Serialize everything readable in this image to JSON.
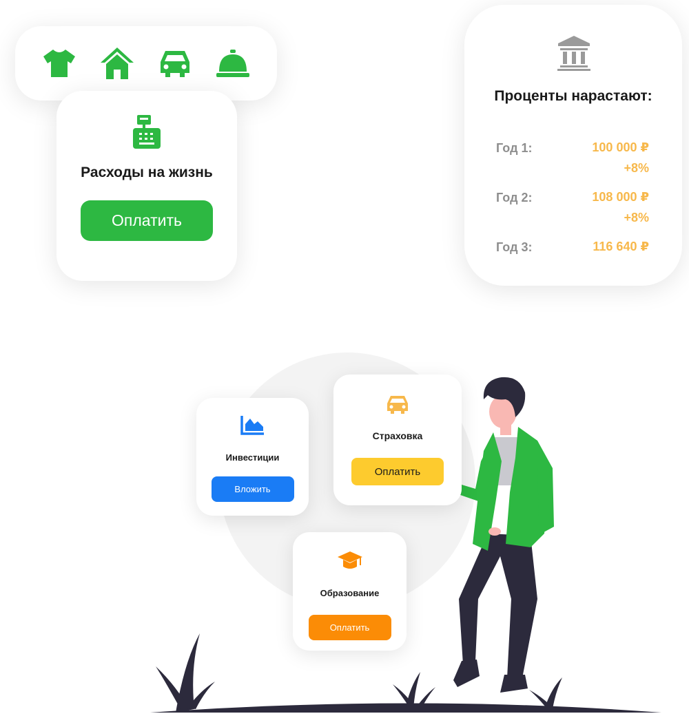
{
  "category_icons": [
    "tshirt-icon",
    "home-icon",
    "car-icon",
    "service-bell-icon"
  ],
  "expenses_card": {
    "icon": "cash-register-icon",
    "title": "Расходы на жизнь",
    "button_label": "Оплатить"
  },
  "interest_card": {
    "icon": "bank-icon",
    "title": "Проценты нарастают:",
    "rows": [
      {
        "label": "Год 1:",
        "value": "100 000 ₽",
        "change": "+8%"
      },
      {
        "label": "Год 2:",
        "value": "108 000 ₽",
        "change": "+8%"
      },
      {
        "label": "Год 3:",
        "value": "116 640 ₽"
      }
    ]
  },
  "investments_card": {
    "icon": "area-chart-icon",
    "title": "Инвестиции",
    "button_label": "Вложить"
  },
  "insurance_card": {
    "icon": "car-icon",
    "title": "Страховка",
    "button_label": "Оплатить"
  },
  "education_card": {
    "icon": "graduation-cap-icon",
    "title": "Образование",
    "button_label": "Оплатить"
  },
  "colors": {
    "green": "#2db842",
    "orange_value": "#f7b84b",
    "grey_label": "#8e8e8e",
    "blue_button": "#1a7cf5",
    "yellow_button": "#fdcb2e",
    "orange_button": "#fb8c06",
    "bank_icon": "#9a9a9a"
  }
}
